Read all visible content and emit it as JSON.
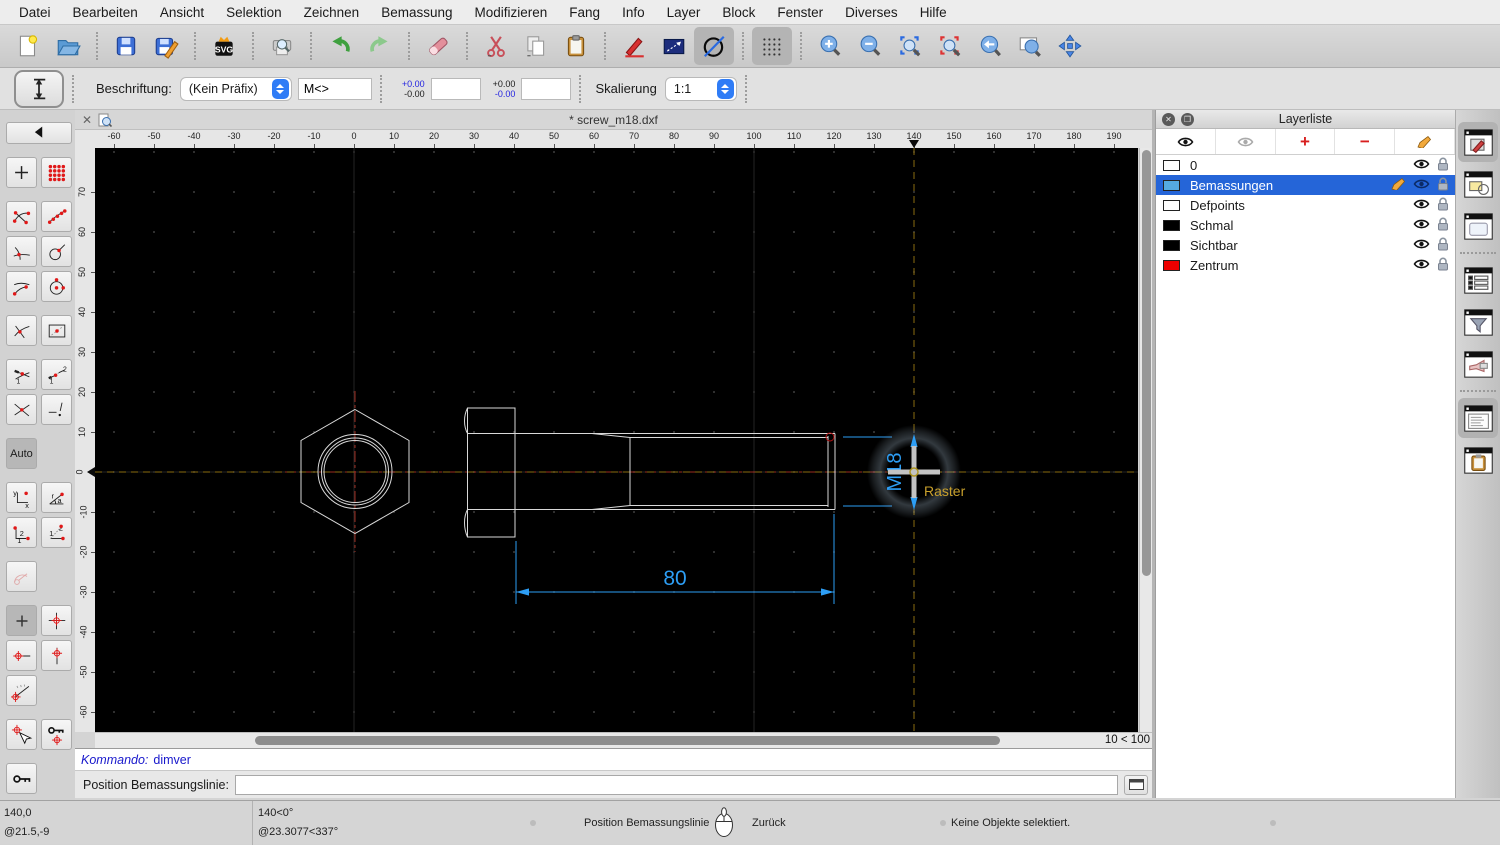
{
  "menu": {
    "items": [
      "Datei",
      "Bearbeiten",
      "Ansicht",
      "Selektion",
      "Zeichnen",
      "Bemassung",
      "Modifizieren",
      "Fang",
      "Info",
      "Layer",
      "Block",
      "Fenster",
      "Diverses",
      "Hilfe"
    ]
  },
  "toolbar": {
    "buttons": [
      {
        "name": "new-file-button"
      },
      {
        "name": "open-file-button"
      },
      {
        "sep": true
      },
      {
        "name": "save-button"
      },
      {
        "name": "save-as-button"
      },
      {
        "sep": true
      },
      {
        "name": "svg-export-button"
      },
      {
        "sep": true
      },
      {
        "name": "print-preview-button"
      },
      {
        "sep": true
      },
      {
        "name": "undo-button"
      },
      {
        "name": "redo-button"
      },
      {
        "sep": true
      },
      {
        "name": "delete-button"
      },
      {
        "sep": true
      },
      {
        "name": "cut-button"
      },
      {
        "name": "copy-button"
      },
      {
        "name": "paste-button"
      },
      {
        "sep": true
      },
      {
        "name": "edit-button"
      },
      {
        "name": "measure-button"
      },
      {
        "name": "draft-mode-button",
        "pressed": true
      },
      {
        "sep": true
      },
      {
        "name": "grid-button",
        "pressed": true
      },
      {
        "sep": true
      },
      {
        "name": "zoom-in-button"
      },
      {
        "name": "zoom-out-button"
      },
      {
        "name": "auto-zoom-button"
      },
      {
        "name": "zoom-selection-button"
      },
      {
        "name": "zoom-previous-button"
      },
      {
        "name": "zoom-window-button"
      },
      {
        "name": "pan-button"
      }
    ]
  },
  "options": {
    "beschriftung_label": "Beschriftung:",
    "praefix_value": "(Kein Präfix)",
    "label_value": "M<>",
    "tol1_top": "+0.00",
    "tol1_bottom": "-0.00",
    "tol2_top": "+0.00",
    "tol2_bottom": "-0.00",
    "skalierung_label": "Skalierung",
    "skalierung_value": "1:1"
  },
  "tabbar": {
    "title": "* screw_m18.dxf"
  },
  "rulers": {
    "h_ticks": [
      -60,
      -50,
      -40,
      -30,
      -20,
      -10,
      0,
      10,
      20,
      30,
      40,
      50,
      60,
      70,
      80,
      90,
      100,
      110,
      120,
      130,
      140,
      150,
      160,
      170,
      180,
      190
    ],
    "v_ticks": [
      70,
      60,
      50,
      40,
      30,
      20,
      10,
      0,
      -10,
      -20,
      -30,
      -40,
      -50,
      -60
    ],
    "h_marker_value": 140,
    "v_marker_value": 0
  },
  "canvas": {
    "dimension_text": "80",
    "preview_dimension_text": "M18",
    "snap_tooltip": "Raster"
  },
  "scroll": {
    "grid_status": "10 < 100"
  },
  "left_toolbar": {
    "tools": [
      {
        "name": "back",
        "wide": true
      },
      {
        "name": "snap-coordinate",
        "gap": true
      },
      {
        "name": "snap-grid"
      },
      {
        "name": "snap-endpoints",
        "gap": true
      },
      {
        "name": "snap-points-on-entity"
      },
      {
        "name": "snap-auto-intersection"
      },
      {
        "name": "snap-on-entity"
      },
      {
        "name": "snap-tangent"
      },
      {
        "name": "snap-center"
      },
      {
        "name": "snap-middle",
        "gap": true
      },
      {
        "name": "snap-reference"
      },
      {
        "name": "snap-intersection-manual",
        "gap": true
      },
      {
        "name": "snap-intersection-manual-2"
      },
      {
        "name": "snap-intersection"
      },
      {
        "name": "snap-perpendicular"
      },
      {
        "name": "snap-auto",
        "single": true,
        "pressed": true,
        "label": "Auto",
        "gap": true
      },
      {
        "name": "coordinate-cartesian",
        "gap": true
      },
      {
        "name": "coordinate-polar"
      },
      {
        "name": "coordinate-relative-cartesian"
      },
      {
        "name": "coordinate-relative-polar"
      },
      {
        "name": "restrict-disabled",
        "single": true,
        "disabled": true,
        "gap": true
      },
      {
        "name": "restrict-none",
        "pressed": true,
        "gap": true
      },
      {
        "name": "restrict-orthogonal"
      },
      {
        "name": "restrict-horizontal"
      },
      {
        "name": "restrict-vertical"
      },
      {
        "name": "restrict-angle",
        "single": true
      },
      {
        "name": "set-relative-zero",
        "gap": true
      },
      {
        "name": "lock-relative-zero"
      },
      {
        "name": "lock-zero",
        "single": true,
        "gap": true
      }
    ]
  },
  "layer_panel": {
    "title": "Layerliste",
    "layers": [
      {
        "name": "0",
        "color": "#ffffff",
        "selected": false
      },
      {
        "name": "Bemassungen",
        "color": "#55aae0",
        "selected": true
      },
      {
        "name": "Defpoints",
        "color": "#ffffff",
        "selected": false
      },
      {
        "name": "Schmal",
        "color": "#000000",
        "selected": false
      },
      {
        "name": "Sichtbar",
        "color": "#000000",
        "selected": false
      },
      {
        "name": "Zentrum",
        "color": "#ee0000",
        "selected": false
      }
    ]
  },
  "right_panel": {
    "icons": [
      {
        "name": "panel-layer-list",
        "active": true
      },
      {
        "name": "panel-block-list"
      },
      {
        "name": "panel-library-browser"
      },
      {
        "sep": true
      },
      {
        "name": "panel-property-editor"
      },
      {
        "name": "panel-selection-filter"
      },
      {
        "name": "panel-view-list"
      },
      {
        "sep": true
      },
      {
        "name": "panel-command-line",
        "active": true
      },
      {
        "name": "panel-clipboard"
      }
    ]
  },
  "command_line": {
    "history_prefix": "Kommando:",
    "history_command": "dimver",
    "prompt_label": "Position Bemassungslinie:",
    "input_value": ""
  },
  "status_bar": {
    "abs_coord": "140,0",
    "rel_coord": "@21.5,-9",
    "abs_polar": "140<0°",
    "rel_polar": "@23.3077<337°",
    "left_click_action": "Position Bemassungslinie",
    "right_click_action": "Zurück",
    "selection_status": "Keine Objekte selektiert."
  },
  "colors": {
    "dimension_blue": "#2d9ef5",
    "crosshair_orange": "#8a6c10",
    "centerline_red": "#9b2b20",
    "snap_tooltip_yellow": "#c8a02c",
    "selection_blue": "#2565d8"
  }
}
